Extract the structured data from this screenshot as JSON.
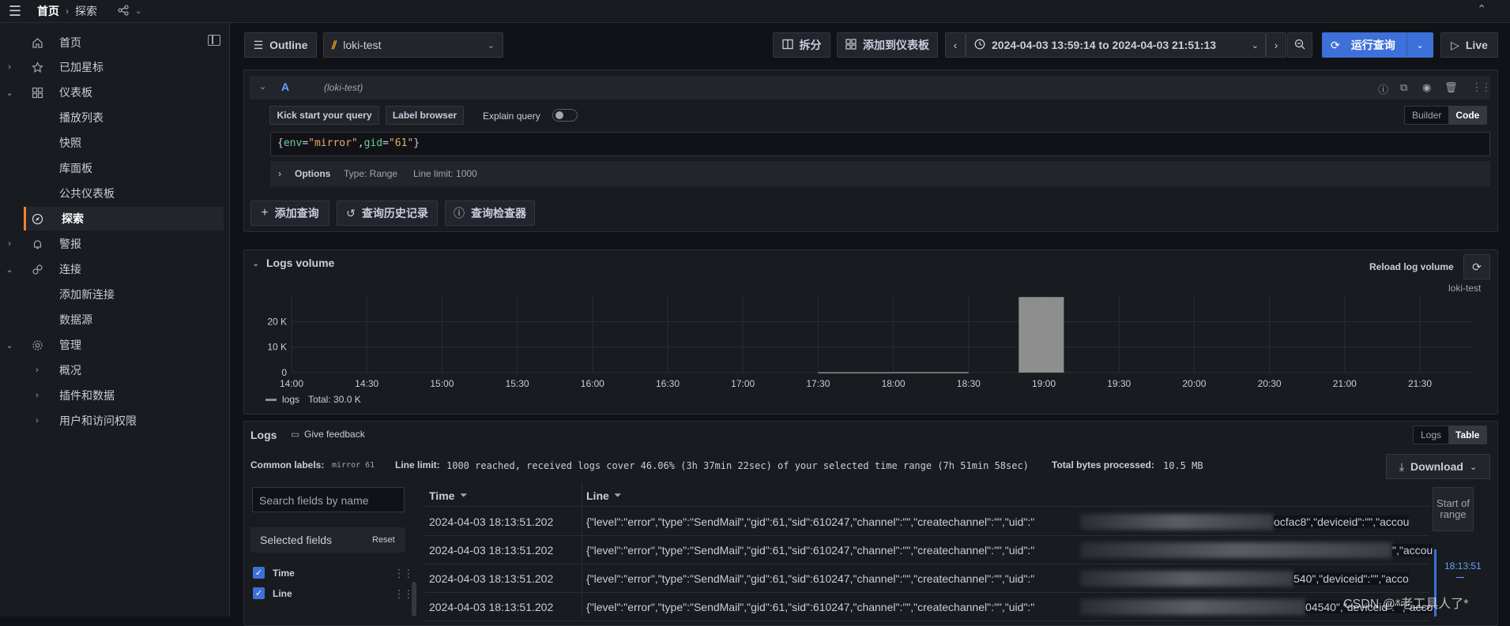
{
  "breadcrumb": {
    "home": "首页",
    "current": "探索"
  },
  "sidebar": {
    "items": [
      {
        "label": "首页",
        "icon": "home-icon"
      },
      {
        "label": "已加星标",
        "icon": "star-icon"
      },
      {
        "label": "仪表板",
        "icon": "dashboard-icon"
      },
      {
        "label": "播放列表"
      },
      {
        "label": "快照"
      },
      {
        "label": "库面板"
      },
      {
        "label": "公共仪表板"
      },
      {
        "label": "探索",
        "icon": "compass-icon"
      },
      {
        "label": "警报",
        "icon": "bell-icon"
      },
      {
        "label": "连接",
        "icon": "link-icon"
      },
      {
        "label": "添加新连接"
      },
      {
        "label": "数据源"
      },
      {
        "label": "管理",
        "icon": "gear-icon"
      },
      {
        "label": "概况"
      },
      {
        "label": "插件和数据"
      },
      {
        "label": "用户和访问权限"
      }
    ]
  },
  "toolbar": {
    "outline": "Outline",
    "datasource": "loki-test",
    "split": "拆分",
    "add_to_dashboard": "添加到仪表板",
    "time_range": "2024-04-03 13:59:14 to 2024-04-03 21:51:13",
    "run_query": "运行查询",
    "live": "Live"
  },
  "query": {
    "ref": "A",
    "datasource_hint": "(loki-test)",
    "kick_start": "Kick start your query",
    "label_browser": "Label browser",
    "explain_query": "Explain query",
    "builder": "Builder",
    "code": "Code",
    "expr_open": "{",
    "expr_key1": "env",
    "expr_eq1": "=",
    "expr_val1": "\"mirror\"",
    "expr_comma": ",",
    "expr_key2": "gid",
    "expr_eq2": "=",
    "expr_val2": "\"61\"",
    "expr_close": "}",
    "options": "Options",
    "type": "Type: Range",
    "line_limit": "Line limit: 1000",
    "add_query": "添加查询",
    "history": "查询历史记录",
    "inspector": "查询检查器"
  },
  "logs_volume": {
    "title": "Logs volume",
    "reload": "Reload log volume",
    "datasource": "loki-test",
    "legend_name": "logs",
    "legend_total": "Total: 30.0 K"
  },
  "chart_data": {
    "type": "bar",
    "x_ticks": [
      "14:00",
      "14:30",
      "15:00",
      "15:30",
      "16:00",
      "16:30",
      "17:00",
      "17:30",
      "18:00",
      "18:30",
      "19:00",
      "19:30",
      "20:00",
      "20:30",
      "21:00",
      "21:30"
    ],
    "y_ticks": [
      "0",
      "10 K",
      "20 K"
    ],
    "ylim": [
      0,
      30000
    ],
    "series": [
      {
        "name": "logs",
        "color": "#8e8e8e",
        "bars": [
          {
            "start": "17:30",
            "end": "18:00",
            "value": 150
          },
          {
            "start": "18:00",
            "end": "18:30",
            "value": 200
          },
          {
            "start": "18:50",
            "end": "19:08",
            "value": 29600
          }
        ]
      }
    ]
  },
  "logs": {
    "title": "Logs",
    "feedback": "Give feedback",
    "view_logs": "Logs",
    "view_table": "Table",
    "common_labels": "Common labels:",
    "common_labels_value": "mirror 61",
    "line_limit_label": "Line limit:",
    "line_limit_value": "1000 reached, received logs cover 46.06% (3h 37min 22sec) of your selected time range (7h 51min 58sec)",
    "bytes_label": "Total bytes processed:",
    "bytes_value": "10.5 MB",
    "download": "Download",
    "search_placeholder": "Search fields by name",
    "selected_fields": "Selected fields",
    "reset": "Reset",
    "fields": [
      "Time",
      "Line"
    ],
    "col_time": "Time",
    "col_line": "Line",
    "start_of_range": "Start of range",
    "mini_time": "18:13:51",
    "rows": [
      {
        "time": "2024-04-03 18:13:51.202",
        "line": "{\"level\":\"error\",\"type\":\"SendMail\",\"gid\":61,\"sid\":610247,\"channel\":\"\",\"createchannel\":\"\",\"uid\":\"",
        "tail": "ocfac8\",\"deviceid\":\"\",\"accou"
      },
      {
        "time": "2024-04-03 18:13:51.202",
        "line": "{\"level\":\"error\",\"type\":\"SendMail\",\"gid\":61,\"sid\":610247,\"channel\":\"\",\"createchannel\":\"\",\"uid\":\"",
        "tail": "\",\"accou"
      },
      {
        "time": "2024-04-03 18:13:51.202",
        "line": "{\"level\":\"error\",\"type\":\"SendMail\",\"gid\":61,\"sid\":610247,\"channel\":\"\",\"createchannel\":\"\",\"uid\":\"",
        "tail": "540\",\"deviceid\":\"\",\"acco"
      },
      {
        "time": "2024-04-03 18:13:51.202",
        "line": "{\"level\":\"error\",\"type\":\"SendMail\",\"gid\":61,\"sid\":610247,\"channel\":\"\",\"createchannel\":\"\",\"uid\":\"",
        "tail": "04540\",\"deviceid\":\"\",\"acco"
      }
    ]
  },
  "watermark": "CSDN @*老工具人了*"
}
